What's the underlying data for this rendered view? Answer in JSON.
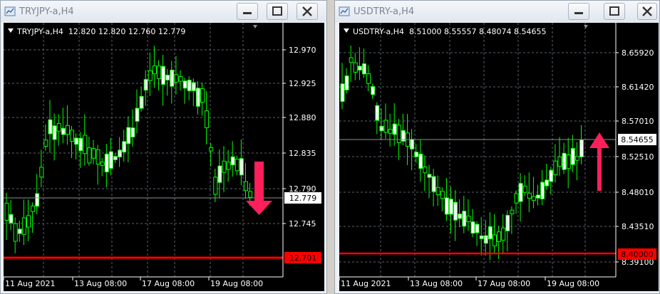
{
  "left": {
    "title": "TRYJPY-a,H4",
    "info": "TRYJPY-a,H4  12.820 12.820 12.760 12.779",
    "y_ticks": [
      "12.970",
      "12.925",
      "12.880",
      "12.835",
      "12.790",
      "12.745"
    ],
    "price_label": "12.779",
    "level_label": "12.701",
    "x_labels": [
      "11 Aug 2021",
      "13 Aug 08:00",
      "17 Aug 08:00",
      "19 Aug 08:00"
    ],
    "arrow": "down"
  },
  "right": {
    "title": "USDTRY-a,H4",
    "info": "USDTRY-a,H4  8.51000 8.55557 8.48074 8.54655",
    "y_ticks": [
      "8.65920",
      "8.61420",
      "8.57010",
      "8.52510",
      "8.48010",
      "8.43510",
      "8.39100"
    ],
    "price_label": "8.54655",
    "level_label": "8.40000",
    "x_labels": [
      "11 Aug 2021",
      "13 Aug 08:00",
      "17 Aug 08:00",
      "19 Aug 08:00"
    ],
    "arrow": "up"
  },
  "colors": {
    "candle": "#00ff00",
    "bull_body": "#ffffff",
    "bear_body": "#000000",
    "grid": "#5a6270",
    "level_line": "#ff0000",
    "arrow": "#ff1f5a",
    "axis_text": "#ffffff"
  },
  "icons": [
    "chart-window-icon",
    "minimize-icon",
    "maximize-icon",
    "close-icon",
    "arrow-down-icon",
    "arrow-up-icon"
  ]
}
